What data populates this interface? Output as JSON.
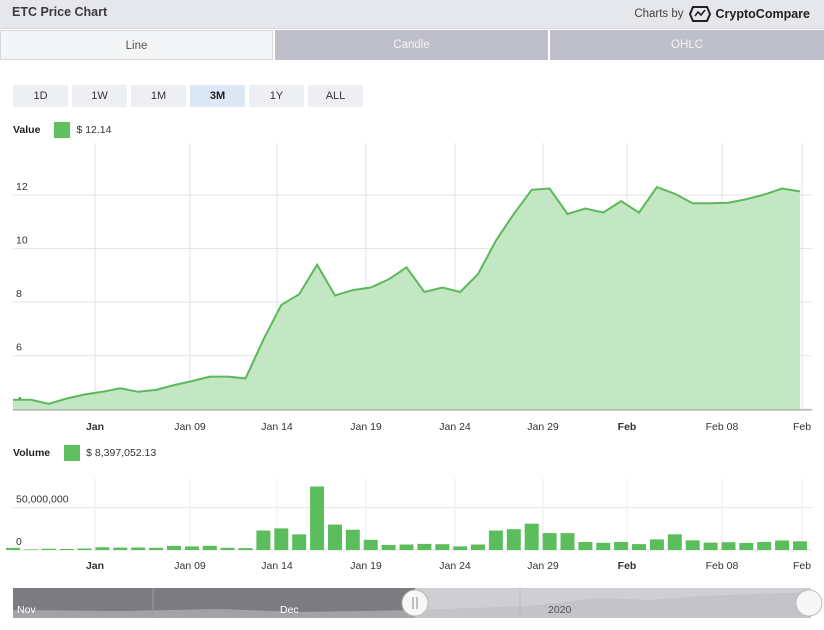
{
  "header": {
    "title": "ETC Price Chart",
    "brand_prefix": "Charts by",
    "brand_name": "CryptoCompare"
  },
  "tabs": [
    {
      "label": "Line",
      "active": true
    },
    {
      "label": "Candle",
      "active": false
    },
    {
      "label": "OHLC",
      "active": false
    }
  ],
  "ranges": [
    {
      "label": "1D",
      "selected": false
    },
    {
      "label": "1W",
      "selected": false
    },
    {
      "label": "1M",
      "selected": false
    },
    {
      "label": "3M",
      "selected": true
    },
    {
      "label": "1Y",
      "selected": false
    },
    {
      "label": "ALL",
      "selected": false
    }
  ],
  "price_legend": {
    "label": "Value",
    "value": "$ 12.14"
  },
  "volume_legend": {
    "label": "Volume",
    "value": "$ 8,397,052.13"
  },
  "colors": {
    "line": "#5cb85c",
    "area": "#c3e6c3",
    "bar": "#5cbd5c",
    "swatch": "#60c060"
  },
  "navigator": {
    "labels": [
      "Nov",
      "Dec",
      "2020"
    ]
  },
  "chart_data": [
    {
      "type": "area",
      "name": "price",
      "x_tick_labels": [
        "Jan",
        "Jan 09",
        "Jan 14",
        "Jan 19",
        "Jan 24",
        "Jan 29",
        "Feb",
        "Feb 08",
        "Feb"
      ],
      "bold_ticks": [
        "Jan",
        "Feb"
      ],
      "y_ticks": [
        4,
        6,
        8,
        10,
        12
      ],
      "ylim": [
        3.97,
        13.95
      ],
      "values": [
        4.35,
        4.35,
        4.2,
        4.4,
        4.55,
        4.65,
        4.78,
        4.65,
        4.72,
        4.9,
        5.05,
        5.22,
        5.22,
        5.15,
        6.6,
        7.9,
        8.3,
        9.4,
        8.25,
        8.45,
        8.55,
        8.85,
        9.3,
        8.38,
        8.55,
        8.38,
        9.05,
        10.3,
        11.3,
        12.2,
        12.25,
        11.3,
        11.5,
        11.35,
        11.78,
        11.35,
        12.3,
        12.05,
        11.7,
        11.7,
        11.72,
        11.85,
        12.02,
        12.25,
        12.14
      ]
    },
    {
      "type": "bar",
      "name": "volume",
      "x_tick_labels": [
        "Jan",
        "Jan 09",
        "Jan 14",
        "Jan 19",
        "Jan 24",
        "Jan 29",
        "Feb",
        "Feb 08",
        "Feb"
      ],
      "y_ticks": [
        0,
        50000000
      ],
      "y_tick_labels": [
        "0",
        "50,000,000"
      ],
      "ylim": [
        0,
        85000000
      ],
      "values": [
        2500000,
        700000,
        1500000,
        1200000,
        1800000,
        3200000,
        2800000,
        2900000,
        2600000,
        4800000,
        4200000,
        4900000,
        2600000,
        2300000,
        23000000,
        25500000,
        18500000,
        75000000,
        30000000,
        24000000,
        12000000,
        6000000,
        6500000,
        7200000,
        6800000,
        4200000,
        6500000,
        23000000,
        24500000,
        31000000,
        20000000,
        20000000,
        9500000,
        8500000,
        9500000,
        7000000,
        12500000,
        18500000,
        11500000,
        8700000,
        9200000,
        8300000,
        9500000,
        11200000,
        10300000
      ]
    }
  ]
}
